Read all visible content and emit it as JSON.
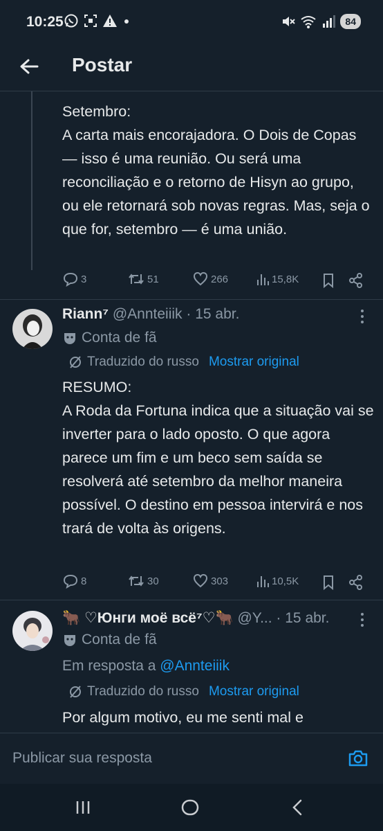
{
  "status_bar": {
    "time": "10:25",
    "battery": "84",
    "left_icons": [
      "whatsapp-icon",
      "screenshot-icon",
      "warning-icon",
      "dot-icon"
    ],
    "right_icons": [
      "mute-icon",
      "wifi-icon",
      "signal-icon"
    ]
  },
  "header": {
    "title": "Postar"
  },
  "tweets": [
    {
      "text": "Setembro:\nA carta mais encorajadora. O Dois de Copas — isso é uma reunião. Ou será uma reconciliação e o retorno de Hisyn ao grupo, ou ele retornará sob novas regras. Mas, seja o que for, setembro — é uma união.",
      "replies": "3",
      "retweets": "51",
      "likes": "266",
      "views": "15,8K"
    },
    {
      "name": "Riann⁷",
      "handle": "@Annteiiik · 15 abr.",
      "fan_label": "Conta de fã",
      "translated_label": "Traduzido do russo",
      "show_original": "Mostrar original",
      "text": "RESUMO:\nA Roda da Fortuna indica que a situação vai se inverter para o lado oposto. O que agora parece um fim e um beco sem saída se resolverá até setembro da melhor maneira possível. O destino em pessoa intervirá e nos trará de volta às origens.",
      "replies": "8",
      "retweets": "30",
      "likes": "303",
      "views": "10,5K"
    },
    {
      "name": "🐂 ♡Юнги моё всё⁷♡🐂",
      "handle": "@Y... · 15 abr.",
      "fan_label": "Conta de fã",
      "reply_to_prefix": "Em resposta a",
      "reply_to_handle": "@Annteiiik",
      "translated_label": "Traduzido do russo",
      "show_original": "Mostrar original",
      "text": "Por algum motivo, eu me senti mal e"
    }
  ],
  "reply_bar": {
    "placeholder": "Publicar sua resposta"
  },
  "colors": {
    "background": "#15202b",
    "text": "#e7e9ea",
    "muted": "#8b98a5",
    "accent": "#1d9bf0",
    "divider": "#2f3c48"
  }
}
